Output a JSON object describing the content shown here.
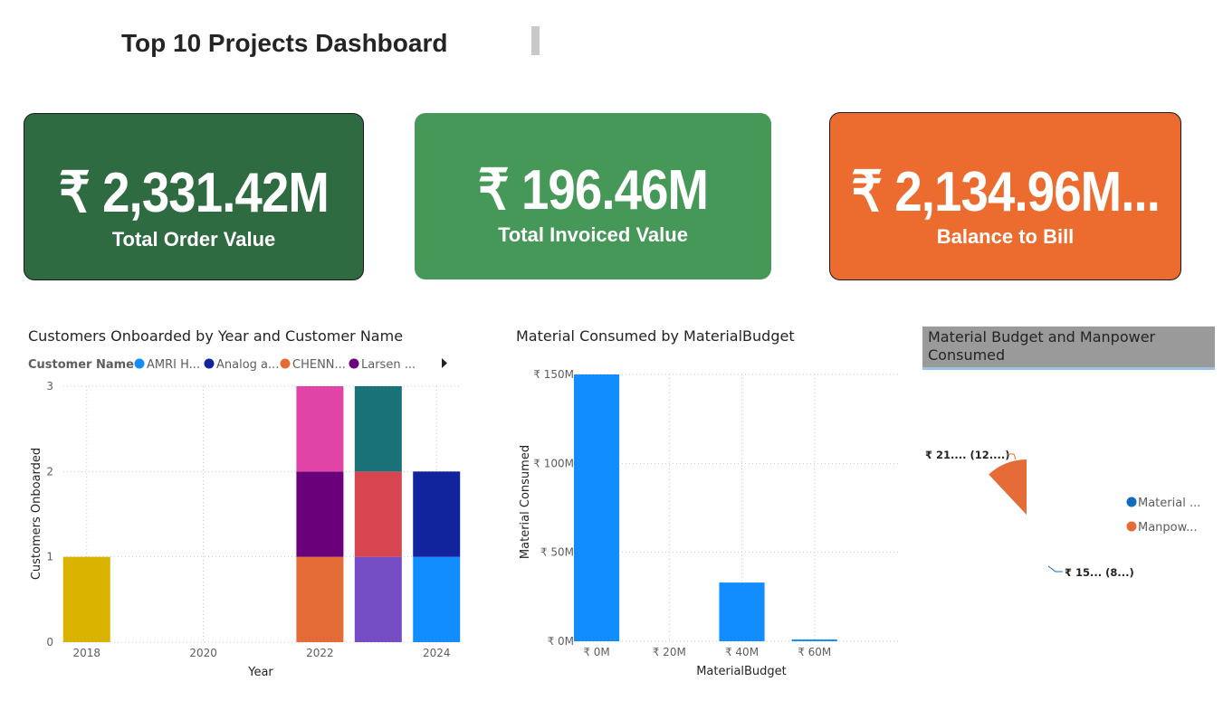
{
  "dashboard": {
    "title": "Top 10 Projects Dashboard"
  },
  "cards": [
    {
      "value": "₹ 2,331.42M",
      "label": "Total Order Value",
      "color": "#2e6b41"
    },
    {
      "value": "₹ 196.46M",
      "label": "Total Invoiced Value",
      "color": "#459858"
    },
    {
      "value": "₹ 2,134.96M...",
      "label": "Balance to Bill",
      "color": "#eb6c2e"
    }
  ],
  "chart1": {
    "title": "Customers Onboarded by Year and Customer Name",
    "legend_title": "Customer Name",
    "legend_items": [
      {
        "label": "AMRI H...",
        "color": "#118dff"
      },
      {
        "label": "Analog a...",
        "color": "#12239e"
      },
      {
        "label": "CHENN...",
        "color": "#e66c37"
      },
      {
        "label": "Larsen ...",
        "color": "#6b007b"
      }
    ],
    "xlabel": "Year",
    "ylabel": "Customers Onboarded"
  },
  "chart2": {
    "title": "Material Consumed by MaterialBudget",
    "xlabel": "MaterialBudget",
    "ylabel": "Material Consumed"
  },
  "chart3": {
    "title_line1": "Material Budget and Manpower",
    "title_line2": "Consumed",
    "legend_items": [
      {
        "label": "Material ...",
        "color": "#0f6cbd"
      },
      {
        "label": "Manpow...",
        "color": "#e66c37"
      }
    ],
    "labels": {
      "manpower": "₹ 21.... (12....)",
      "material": "₹ 15... (8...)"
    }
  },
  "chart_data": [
    {
      "type": "bar",
      "stacked": true,
      "title": "Customers Onboarded by Year and Customer Name",
      "xlabel": "Year",
      "ylabel": "Customers Onboarded",
      "ylim": [
        0,
        3
      ],
      "yticks": [
        "0",
        "1",
        "2",
        "3"
      ],
      "xticks": [
        "2018",
        "2020",
        "2022",
        "2024"
      ],
      "grid": true,
      "legend_position": "top",
      "bars": [
        {
          "year": 2018,
          "segments": [
            {
              "color": "#d9b300",
              "value": 1
            }
          ]
        },
        {
          "year": 2022,
          "segments": [
            {
              "color": "#e66c37",
              "value": 1
            },
            {
              "color": "#6b007b",
              "value": 1
            },
            {
              "color": "#e044a7",
              "value": 1
            }
          ]
        },
        {
          "year": 2023,
          "segments": [
            {
              "color": "#744ec2",
              "value": 1
            },
            {
              "color": "#d64550",
              "value": 1
            },
            {
              "color": "#197278",
              "value": 1
            }
          ]
        },
        {
          "year": 2024,
          "segments": [
            {
              "color": "#118dff",
              "value": 1
            },
            {
              "color": "#12239e",
              "value": 1
            }
          ]
        }
      ]
    },
    {
      "type": "bar",
      "title": "Material Consumed by MaterialBudget",
      "xlabel": "MaterialBudget",
      "ylabel": "Material Consumed",
      "xlim": [
        -5,
        83
      ],
      "ylim": [
        0,
        150
      ],
      "xticks": [
        "₹ 0M",
        "₹ 20M",
        "₹ 40M",
        "₹ 60M"
      ],
      "yticks": [
        "₹ 0M",
        "₹ 50M",
        "₹ 100M",
        "₹ 150M"
      ],
      "grid": true,
      "color": "#118dff",
      "points": [
        {
          "x": 0,
          "y": 150
        },
        {
          "x": 40,
          "y": 33
        },
        {
          "x": 60,
          "y": 1
        }
      ]
    },
    {
      "type": "pie",
      "title": "Material Budget and Manpower Consumed",
      "legend_position": "right",
      "slices": [
        {
          "label": "Material ...",
          "value": 88,
          "color": "#0f6cbd"
        },
        {
          "label": "Manpow...",
          "value": 12,
          "color": "#e66c37"
        }
      ]
    }
  ]
}
